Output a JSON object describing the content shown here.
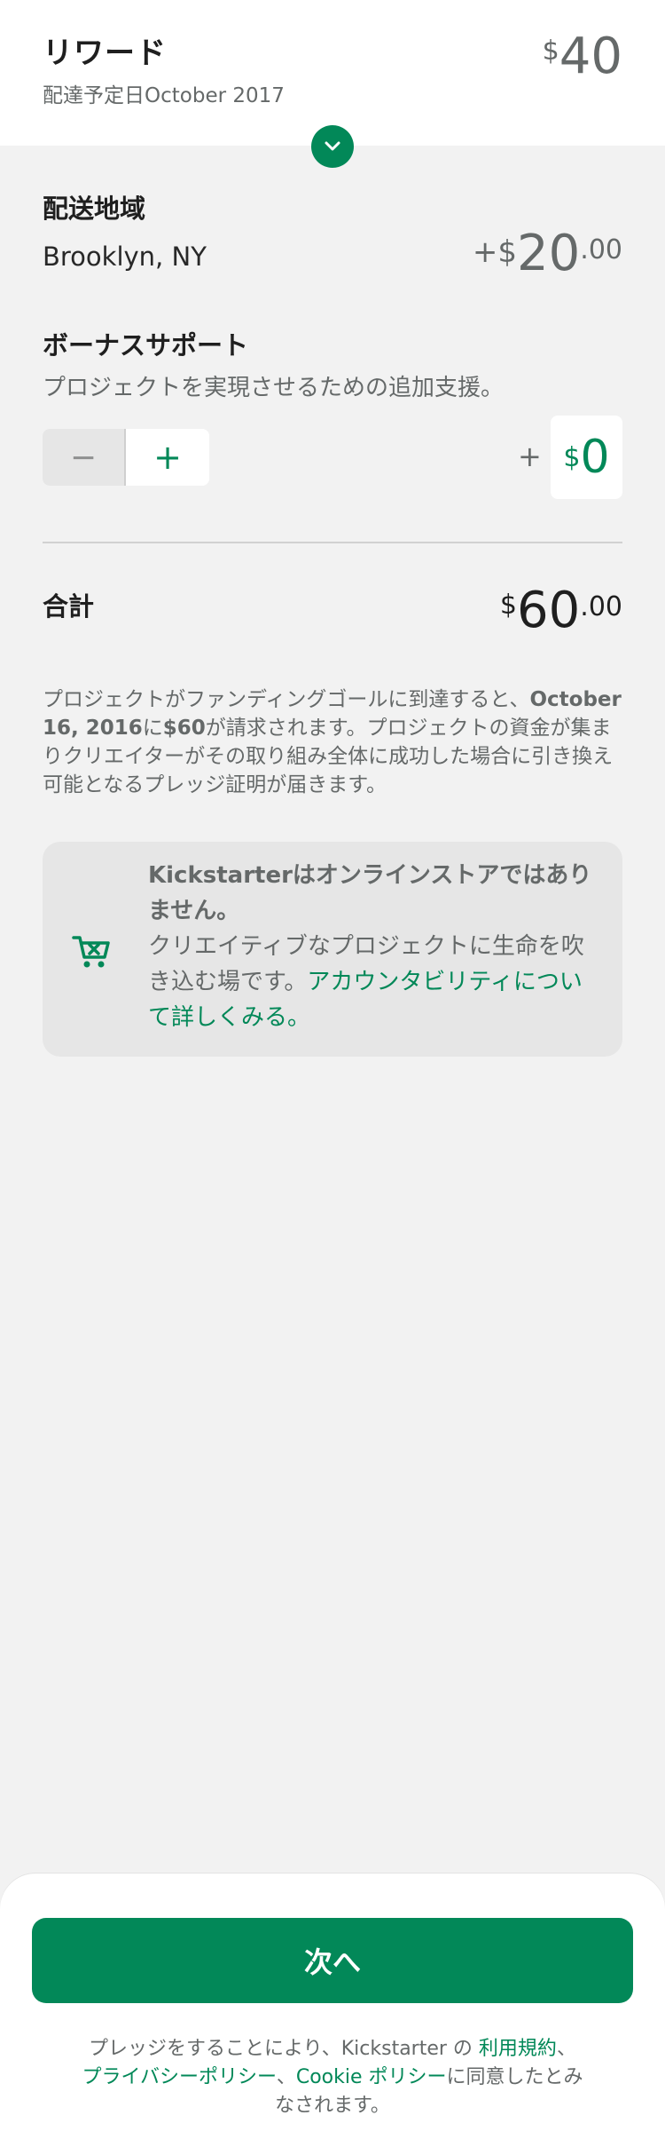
{
  "reward": {
    "title": "リワード",
    "delivery_date": "配達予定日October 2017",
    "currency": "$",
    "amount": "40"
  },
  "shipping": {
    "label": "配送地域",
    "location": "Brooklyn, NY",
    "prefix": "+$",
    "amount": "20",
    "cents": ".00"
  },
  "bonus": {
    "label": "ボーナスサポート",
    "description": "プロジェクトを実現させるための追加支援。",
    "minus": "−",
    "plus": "+",
    "amount_prefix": "+",
    "currency": "$",
    "amount": "0"
  },
  "total": {
    "label": "合計",
    "currency": "$",
    "amount": "60",
    "cents": ".00"
  },
  "note": {
    "part1": "プロジェクトがファンディングゴールに到達すると、",
    "date": "October 16, 2016",
    "part2": "に",
    "amount": "$60",
    "part3": "が請求されます。プロジェクトの資金が集まりクリエイターがその取り組み全体に成功した場合に引き換え可能となるプレッジ証明が届きます。"
  },
  "info": {
    "heading": "Kickstarterはオンラインストアではありません。",
    "body": "クリエイティブなプロジェクトに生命を吹き込む場です。",
    "link": "アカウンタビリティについて詳しくみる。",
    "icon": "cart-icon"
  },
  "footer": {
    "next_label": "次へ",
    "terms_pre": "プレッジをすることにより、Kickstarter の ",
    "terms_link": "利用規約",
    "sep": "、",
    "privacy_link": "プライバシーポリシー",
    "sep2": "、",
    "cookie_link": "Cookie ポリシー",
    "terms_post": "に同意したとみなされます。"
  },
  "colors": {
    "accent": "#028858",
    "background": "#f2f2f2",
    "text_secondary": "#656969"
  }
}
